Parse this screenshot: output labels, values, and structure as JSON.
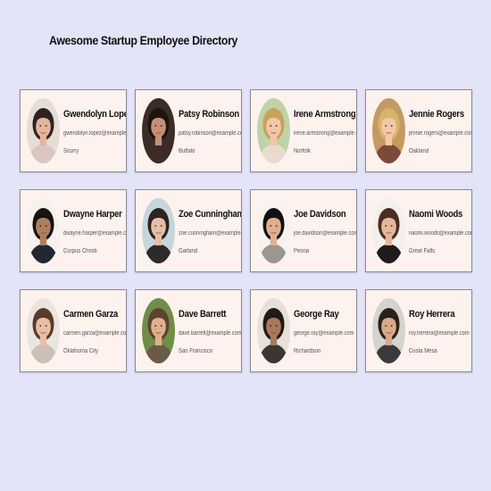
{
  "page": {
    "title": "Awesome Startup Employee Directory",
    "background": "#e4e4f8",
    "card_background": "#fdf2ee"
  },
  "employees": [
    {
      "name": "Gwendolyn Lopez",
      "email": "gwendolyn.lopez@example.com",
      "city": "Scurry",
      "avatar": "avatar-photo",
      "bg": "#e6dcd6",
      "skin": "#e3b59c",
      "hair": "#2e2220",
      "shirt": "#d9c7bf"
    },
    {
      "name": "Patsy Robinson",
      "email": "patsy.robinson@example.com",
      "city": "Buffalo",
      "avatar": "avatar-photo",
      "bg": "#3a2d28",
      "skin": "#c79076",
      "hair": "#1e1411",
      "shirt": "#3b2c26"
    },
    {
      "name": "Irene Armstrong",
      "email": "irene.armstrong@example.com",
      "city": "Norfolk",
      "avatar": "avatar-photo",
      "bg": "#bfd3a6",
      "skin": "#f0c7a8",
      "hair": "#c9a15d",
      "shirt": "#e9dccd"
    },
    {
      "name": "Jennie Rogers",
      "email": "jennie.rogers@example.com",
      "city": "Oakland",
      "avatar": "avatar-photo",
      "bg": "#c49a62",
      "skin": "#f1c9a6",
      "hair": "#d8b36b",
      "shirt": "#7a4a3a"
    },
    {
      "name": "Dwayne Harper",
      "email": "dwayne.harper@example.com",
      "city": "Corpus Christi",
      "avatar": "avatar-photo",
      "bg": "#f4f1ee",
      "skin": "#b07f5e",
      "hair": "#181210",
      "shirt": "#222831"
    },
    {
      "name": "Zoe Cunningham",
      "email": "zoe.cunningham@example.com",
      "city": "Garland",
      "avatar": "avatar-photo",
      "bg": "#c7d6db",
      "skin": "#e6bfa5",
      "hair": "#2b2422",
      "shirt": "#2c2a2a"
    },
    {
      "name": "Joe Davidson",
      "email": "joe.davidson@example.com",
      "city": "Peoria",
      "avatar": "avatar-photo",
      "bg": "#f6f3ef",
      "skin": "#e0b08e",
      "hair": "#131111",
      "shirt": "#9a9690"
    },
    {
      "name": "Naomi Woods",
      "email": "naomi.woods@example.com",
      "city": "Great Falls",
      "avatar": "avatar-photo",
      "bg": "#f3efea",
      "skin": "#e5b89b",
      "hair": "#4a2d22",
      "shirt": "#1d1b1b"
    },
    {
      "name": "Carmen Garza",
      "email": "carmen.garza@example.com",
      "city": "Oklahoma City",
      "avatar": "avatar-photo",
      "bg": "#e9e5e1",
      "skin": "#e8bfa3",
      "hair": "#5a3a2a",
      "shirt": "#ccbfb6"
    },
    {
      "name": "Dave Barrett",
      "email": "dave.barrett@example.com",
      "city": "San Francisco",
      "avatar": "avatar-photo",
      "bg": "#6f8e46",
      "skin": "#e0b08e",
      "hair": "#5e4330",
      "shirt": "#6b5a45"
    },
    {
      "name": "George Ray",
      "email": "george.ray@example.com",
      "city": "Richardson",
      "avatar": "avatar-photo",
      "bg": "#e6e0d8",
      "skin": "#a9795b",
      "hair": "#1f1a17",
      "shirt": "#3b3632"
    },
    {
      "name": "Roy Herrera",
      "email": "roy.herrera@example.com",
      "city": "Costa Mesa",
      "avatar": "avatar-photo",
      "bg": "#d5d3d0",
      "skin": "#d9a98a",
      "hair": "#2a201c",
      "shirt": "#3a3a3c"
    }
  ]
}
